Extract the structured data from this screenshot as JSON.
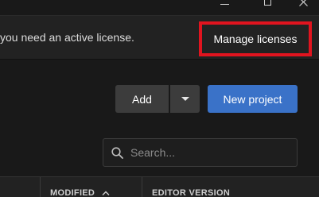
{
  "window": {
    "minimize_icon": "minimize-icon",
    "maximize_icon": "maximize-icon",
    "close_icon": "close-icon"
  },
  "banner": {
    "text": "you need an active license.",
    "manage_label": "Manage licenses",
    "highlight_color": "#e1141f"
  },
  "toolbar": {
    "add_label": "Add",
    "add_dropdown_icon": "caret-down-icon",
    "new_project_label": "New project",
    "accent_color": "#3a72c8"
  },
  "search": {
    "placeholder": "Search...",
    "value": "",
    "icon": "search-icon"
  },
  "table": {
    "columns": [
      {
        "label": "MODIFIED",
        "sort_icon": "sort-asc-icon"
      },
      {
        "label": "EDITOR VERSION"
      }
    ]
  }
}
